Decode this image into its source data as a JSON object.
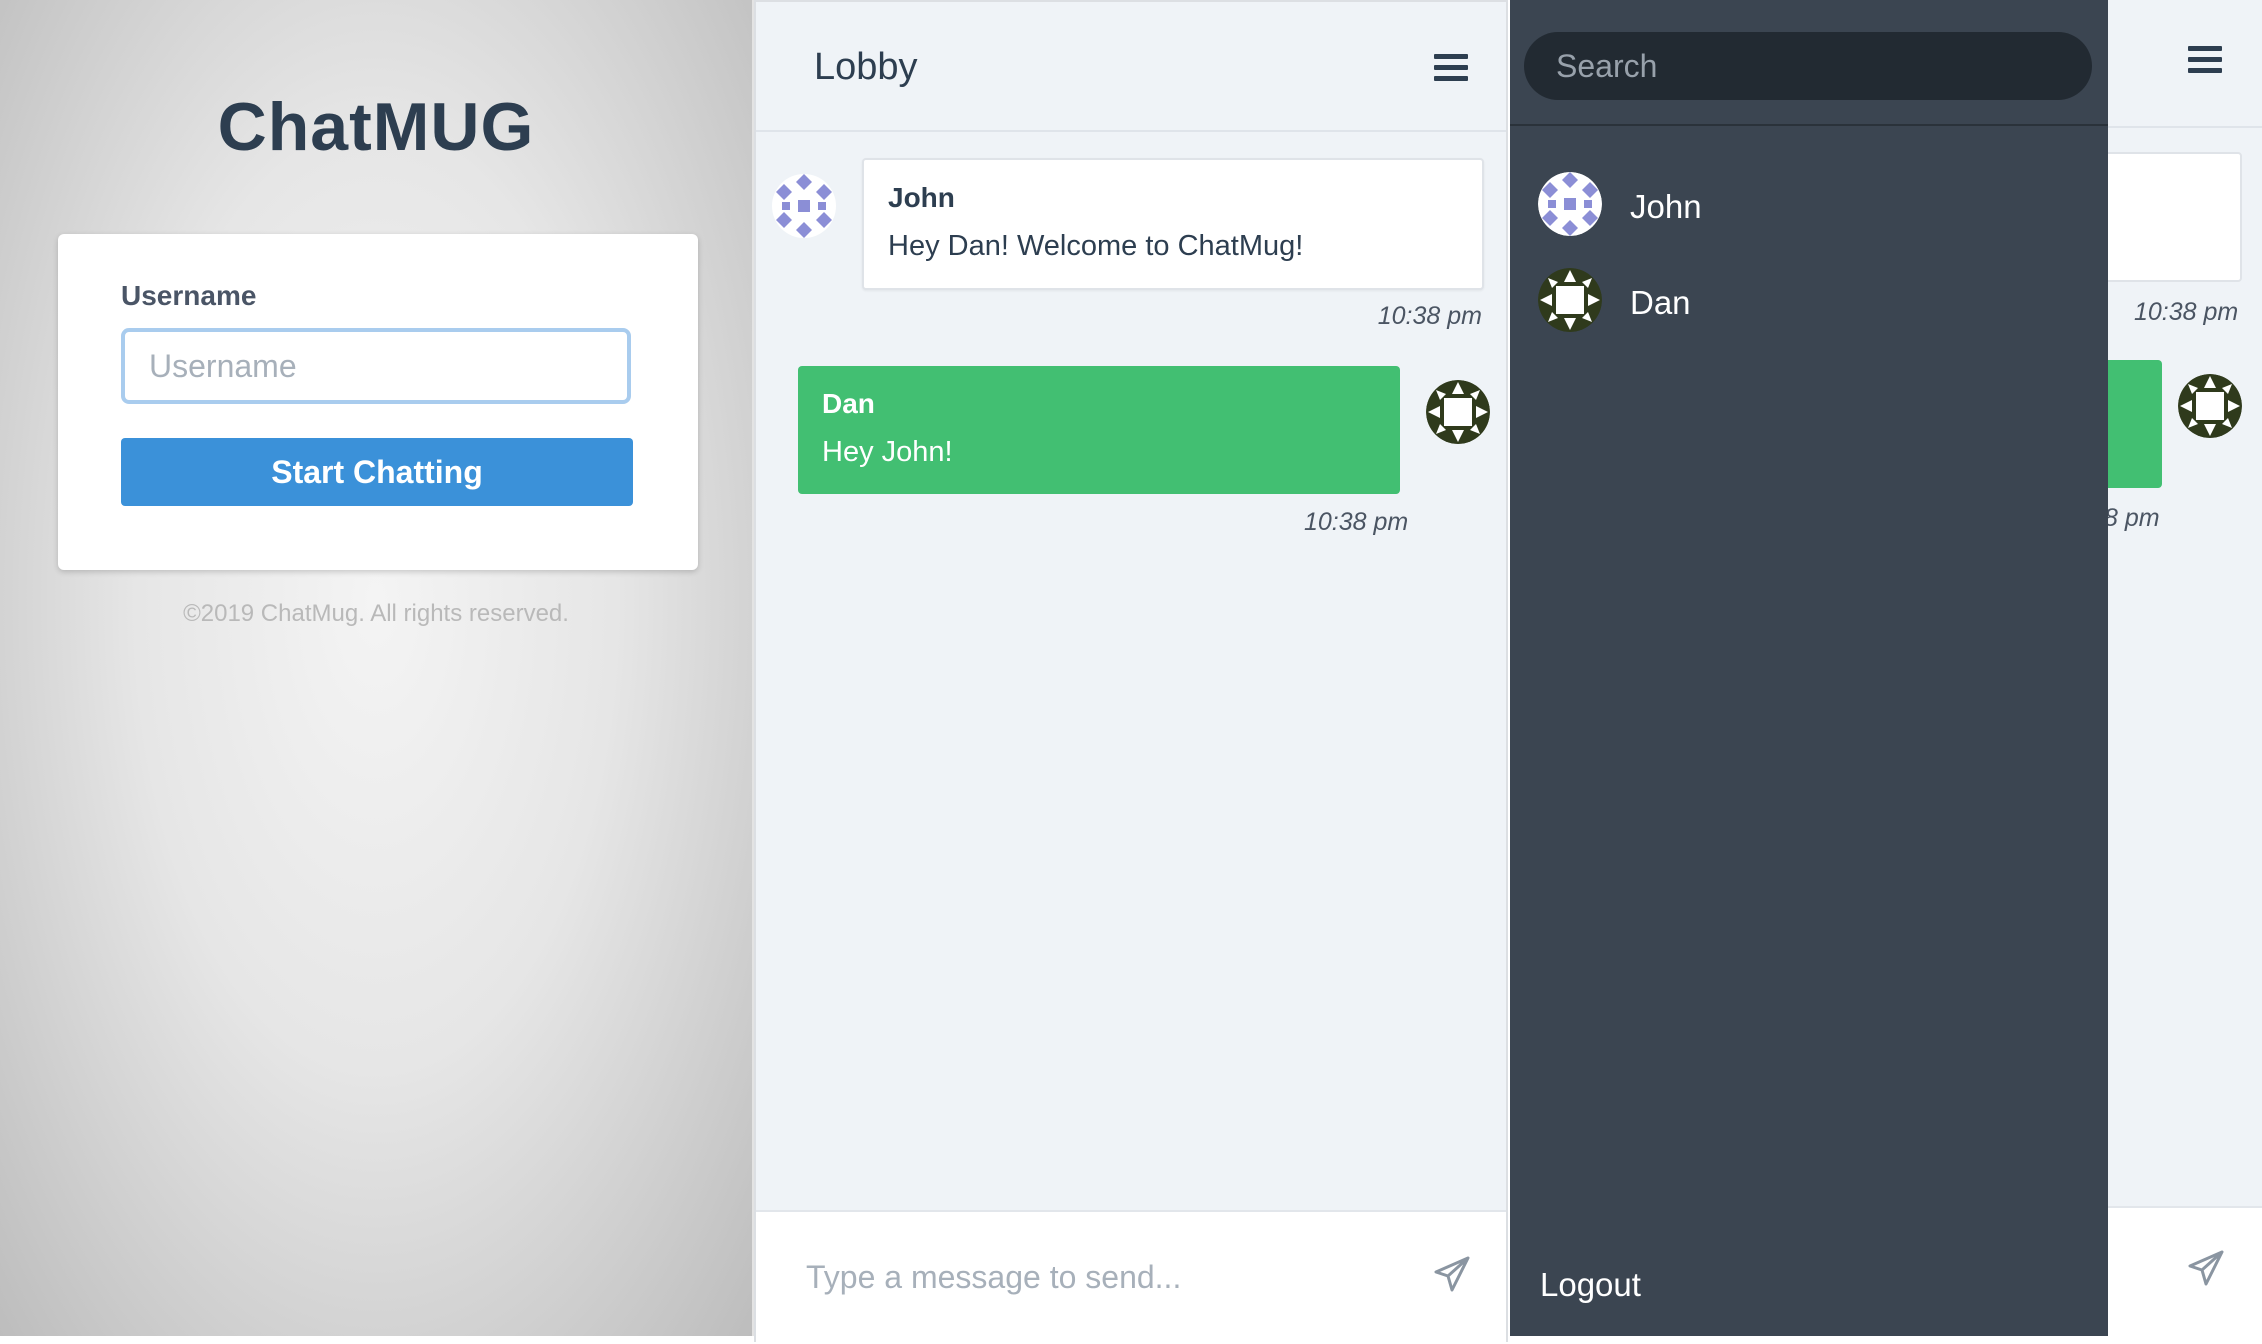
{
  "login": {
    "title": "ChatMUG",
    "username_label": "Username",
    "username_placeholder": "Username",
    "username_value": "",
    "start_button": "Start Chatting",
    "footer": "©2019 ChatMug. All rights reserved."
  },
  "chat": {
    "room_title": "Lobby",
    "menu_icon": "hamburger-menu-icon",
    "messages": [
      {
        "author": "John",
        "text": "Hey Dan! Welcome to ChatMug!",
        "time": "10:38 pm",
        "direction": "incoming"
      },
      {
        "author": "Dan",
        "text": "Hey John!",
        "time": "10:38 pm",
        "direction": "outgoing"
      }
    ],
    "composer_placeholder": "Type a message to send...",
    "send_icon": "paper-plane-icon"
  },
  "drawer": {
    "search_placeholder": "Search",
    "users": [
      {
        "name": "John"
      },
      {
        "name": "Dan"
      }
    ],
    "logout": "Logout",
    "background_times": [
      "10:38 pm",
      "8 pm"
    ]
  },
  "colors": {
    "brand_dark": "#2d3e50",
    "primary_button": "#3b91d9",
    "outgoing_bubble": "#42bf72",
    "drawer_bg": "#3b4551",
    "search_bg": "#222a32",
    "chat_bg": "#eff3f7"
  }
}
